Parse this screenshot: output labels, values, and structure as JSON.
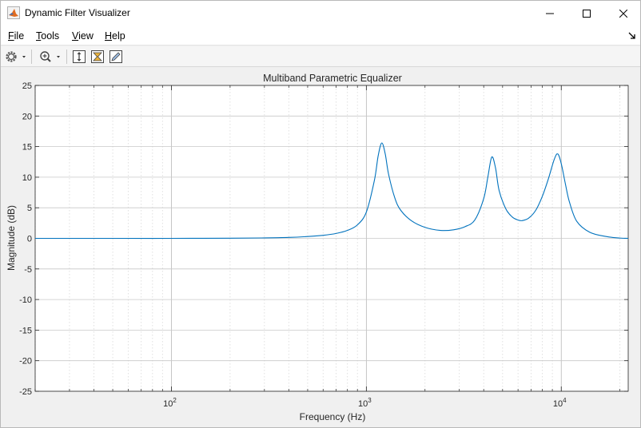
{
  "window": {
    "title": "Dynamic Filter Visualizer",
    "controls": [
      "minimize",
      "maximize",
      "close"
    ]
  },
  "menu": {
    "items": [
      {
        "label": "File",
        "mnemonic": "F",
        "rest": "ile"
      },
      {
        "label": "Tools",
        "mnemonic": "T",
        "rest": "ools"
      },
      {
        "label": "View",
        "mnemonic": "V",
        "rest": "iew"
      },
      {
        "label": "Help",
        "mnemonic": "H",
        "rest": "elp"
      }
    ]
  },
  "toolbar": {
    "buttons": [
      "settings-icon",
      "zoom-in-icon",
      "autoscale-y-icon",
      "frequency-range-icon",
      "pen-edit-icon"
    ]
  },
  "chart_data": {
    "type": "line",
    "title": "Multiband Parametric Equalizer",
    "xlabel": "Frequency (Hz)",
    "ylabel": "Magnitude (dB)",
    "xscale": "log",
    "xlim": [
      20,
      22050
    ],
    "ylim": [
      -25,
      25
    ],
    "yticks": [
      25,
      20,
      15,
      10,
      5,
      0,
      -5,
      -10,
      -15,
      -20,
      -25
    ],
    "xticks": [
      {
        "value": 100,
        "base": "10",
        "exp": "2"
      },
      {
        "value": 1000,
        "base": "10",
        "exp": "3"
      },
      {
        "value": 10000,
        "base": "10",
        "exp": "4"
      }
    ],
    "grid": true,
    "line_color": "#0072bd",
    "series": [
      {
        "x": [
          20,
          50,
          100,
          200,
          300,
          400,
          500,
          600,
          700,
          800,
          900,
          1000,
          1100,
          1150,
          1200,
          1250,
          1300,
          1400,
          1500,
          1700,
          2000,
          2400,
          2800,
          3200,
          3600,
          4000,
          4200,
          4400,
          4600,
          4800,
          5200,
          5600,
          6000,
          6300,
          6800,
          7400,
          8000,
          8600,
          9200,
          9600,
          10000,
          10500,
          11000,
          12000,
          14000,
          17000,
          20000,
          22050
        ],
        "y": [
          0,
          0,
          0,
          0.02,
          0.07,
          0.15,
          0.3,
          0.5,
          0.8,
          1.3,
          2.2,
          4.3,
          9.5,
          13.5,
          15.6,
          13.8,
          10.5,
          6.6,
          4.6,
          2.9,
          1.8,
          1.3,
          1.4,
          1.9,
          3.0,
          6.5,
          10.0,
          13.3,
          11.5,
          7.8,
          4.8,
          3.5,
          3.0,
          2.9,
          3.3,
          4.6,
          6.9,
          9.8,
          12.9,
          13.8,
          12.2,
          8.9,
          6.0,
          2.8,
          1.0,
          0.3,
          0.05,
          0
        ]
      }
    ]
  }
}
